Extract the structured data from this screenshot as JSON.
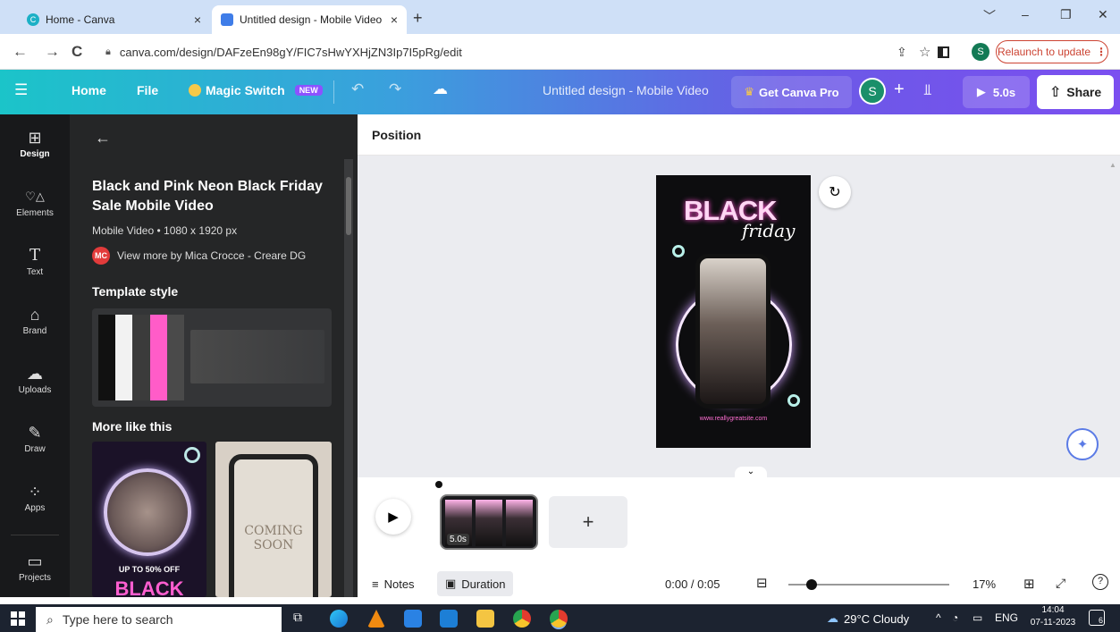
{
  "browser": {
    "tabs": [
      {
        "title": "Home - Canva",
        "close": "×"
      },
      {
        "title": "Untitled design - Mobile Video",
        "close": "×"
      }
    ],
    "new_tab": "+",
    "window_controls": [
      "﹀",
      "–",
      "❐",
      "✕"
    ],
    "url": "canva.com/design/DAFzeEn98gY/FIC7sHwYXHjZN3Ip7I5pRg/edit",
    "profile_initial": "S",
    "relaunch_label": "Relaunch to update"
  },
  "canva_header": {
    "menu_icon": "☰",
    "home": "Home",
    "file": "File",
    "magic_switch": "Magic Switch",
    "new_badge": "NEW",
    "doc_title": "Untitled design - Mobile Video",
    "get_pro": "Get Canva Pro",
    "avatar_initial": "S",
    "add": "+",
    "play_duration": "5.0s",
    "share": "Share"
  },
  "rail": [
    {
      "label": "Design",
      "icon": "⊞"
    },
    {
      "label": "Elements",
      "icon": "♡△"
    },
    {
      "label": "Text",
      "icon": "T"
    },
    {
      "label": "Brand",
      "icon": "⌂"
    },
    {
      "label": "Uploads",
      "icon": "☁"
    },
    {
      "label": "Draw",
      "icon": "✎"
    },
    {
      "label": "Apps",
      "icon": "⁘"
    },
    {
      "label": "Projects",
      "icon": "▭"
    }
  ],
  "panel": {
    "back": "←",
    "title": "Black and Pink Neon Black Friday Sale Mobile Video",
    "subtitle": "Mobile Video • 1080 x 1920 px",
    "author_badge": "MC",
    "author": "View more by Mica Crocce - Creare DG",
    "template_style": "Template style",
    "more_like_this": "More like this",
    "style_colors": [
      "#111111",
      "#f2f2f2",
      "#3b3b3b",
      "#ff5cc8",
      "#4a4a4a"
    ],
    "thumb1_text1": "UP TO 50% OFF",
    "thumb1_text2": "BLACK",
    "thumb2_text1": "COMING",
    "thumb2_text2": "SOON"
  },
  "editor": {
    "toolbar_label": "Position",
    "design_headline": "BLACK",
    "design_script": "friday",
    "design_url": "www.reallygreatsite.com",
    "clip_duration": "5.0s",
    "add_clip": "+",
    "notes": "Notes",
    "duration": "Duration",
    "time": "0:00 / 0:05",
    "zoom": "17%"
  },
  "taskbar": {
    "search_placeholder": "Type here to search",
    "weather": "29°C  Cloudy",
    "lang": "ENG",
    "time": "14:04",
    "date": "07-11-2023",
    "notif_count": "6"
  }
}
